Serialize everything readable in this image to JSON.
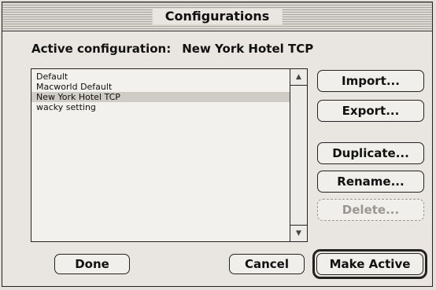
{
  "window": {
    "title": "Configurations"
  },
  "active": {
    "label": "Active configuration:",
    "value": "New York Hotel TCP"
  },
  "list": {
    "items": [
      "Default",
      "Macworld Default",
      "New York Hotel TCP",
      "wacky setting"
    ],
    "selected_index": 2
  },
  "icons": {
    "scroll_up": "scroll-up-arrow-icon",
    "scroll_down": "scroll-down-arrow-icon"
  },
  "buttons": {
    "import": "Import...",
    "export": "Export...",
    "duplicate": "Duplicate...",
    "rename": "Rename...",
    "delete": "Delete...",
    "done": "Done",
    "cancel": "Cancel",
    "make_active": "Make Active"
  }
}
